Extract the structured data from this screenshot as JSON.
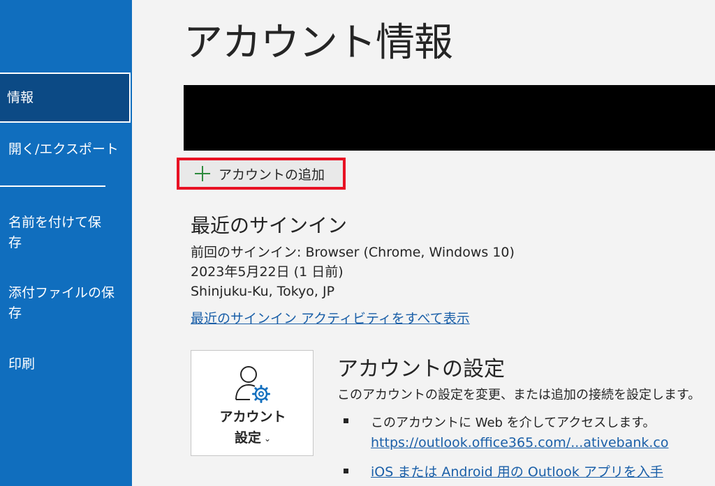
{
  "sidebar": {
    "items": [
      {
        "label": "情報"
      },
      {
        "label": "開く/エクスポート"
      },
      {
        "label": "名前を付けて保存"
      },
      {
        "label": "添付ファイルの保存"
      },
      {
        "label": "印刷"
      }
    ],
    "item_lines": {
      "save_as_line1": "名前を付けて保",
      "save_as_line2": "存",
      "save_attach_line1": "添付ファイルの保",
      "save_attach_line2": "存"
    }
  },
  "main": {
    "title": "アカウント情報",
    "add_account_label": "アカウントの追加",
    "recent_signin": {
      "title": "最近のサインイン",
      "last_signin": "前回のサインイン: Browser (Chrome, Windows 10)",
      "date": "2023年5月22日 (1 日前)",
      "location": "Shinjuku-Ku, Tokyo, JP",
      "view_all_link": "最近のサインイン アクティビティをすべて表示"
    },
    "account_settings": {
      "tile_label_line1": "アカウント",
      "tile_label_line2": "設定",
      "title": "アカウントの設定",
      "description": "このアカウントの設定を変更、または追加の接続を設定します。",
      "bullets": [
        {
          "text": "このアカウントに Web を介してアクセスします。"
        },
        {
          "link": "https://outlook.office365.com/...ativebank.co"
        },
        {
          "link": "iOS または Android 用の Outlook アプリを入手"
        }
      ]
    }
  },
  "colors": {
    "sidebar_bg": "#106ebe",
    "sidebar_selected_bg": "#0c4a85",
    "highlight_border": "#e81123",
    "plus_icon": "#2e8b3e",
    "link": "#1a5fa8",
    "gear_icon": "#106ebe"
  }
}
